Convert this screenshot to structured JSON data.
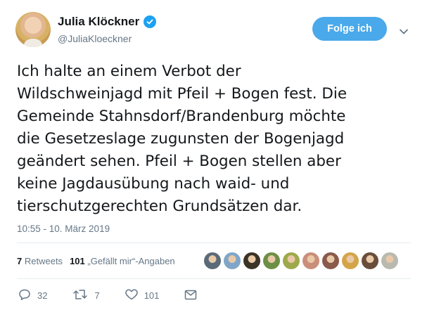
{
  "author": {
    "display_name": "Julia Klöckner",
    "handle": "@JuliaKloeckner",
    "verified_icon": "verified-badge-icon"
  },
  "follow_button": {
    "label": "Folge ich"
  },
  "tweet": {
    "text": "Ich halte an einem Verbot der\nWildschweinjagd mit Pfeil + Bogen fest. Die\nGemeinde Stahnsdorf/Brandenburg möchte\ndie Gesetzeslage zugunsten der Bogenjagd\ngeändert sehen. Pfeil + Bogen stellen aber\nkeine Jagdausübung nach waid- und\ntierschutzgerechten Grundsätzen dar.",
    "timestamp": "10:55 - 10. März 2019"
  },
  "stats": {
    "retweets_count": "7",
    "retweets_label": "Retweets",
    "likes_count": "101",
    "likes_label": "„Gefällt mir“-Angaben"
  },
  "liker_avatars": [
    {
      "name": "liker-avatar-1",
      "color": "#5a6b78"
    },
    {
      "name": "liker-avatar-2",
      "color": "#7fa6c8"
    },
    {
      "name": "liker-avatar-3",
      "color": "#3b3326"
    },
    {
      "name": "liker-avatar-4",
      "color": "#6c8f46"
    },
    {
      "name": "liker-avatar-5",
      "color": "#9ea94c"
    },
    {
      "name": "liker-avatar-6",
      "color": "#c98f7b"
    },
    {
      "name": "liker-avatar-7",
      "color": "#8a5a4a"
    },
    {
      "name": "liker-avatar-8",
      "color": "#d4a548"
    },
    {
      "name": "liker-avatar-9",
      "color": "#6a4e3a"
    },
    {
      "name": "liker-avatar-10",
      "color": "#b9b9b0"
    }
  ],
  "actions": {
    "reply_count": "32",
    "retweet_count": "7",
    "like_count": "101"
  },
  "colors": {
    "accent": "#1da1f2",
    "follow_button": "#4aa9ea",
    "muted_text": "#657786"
  }
}
